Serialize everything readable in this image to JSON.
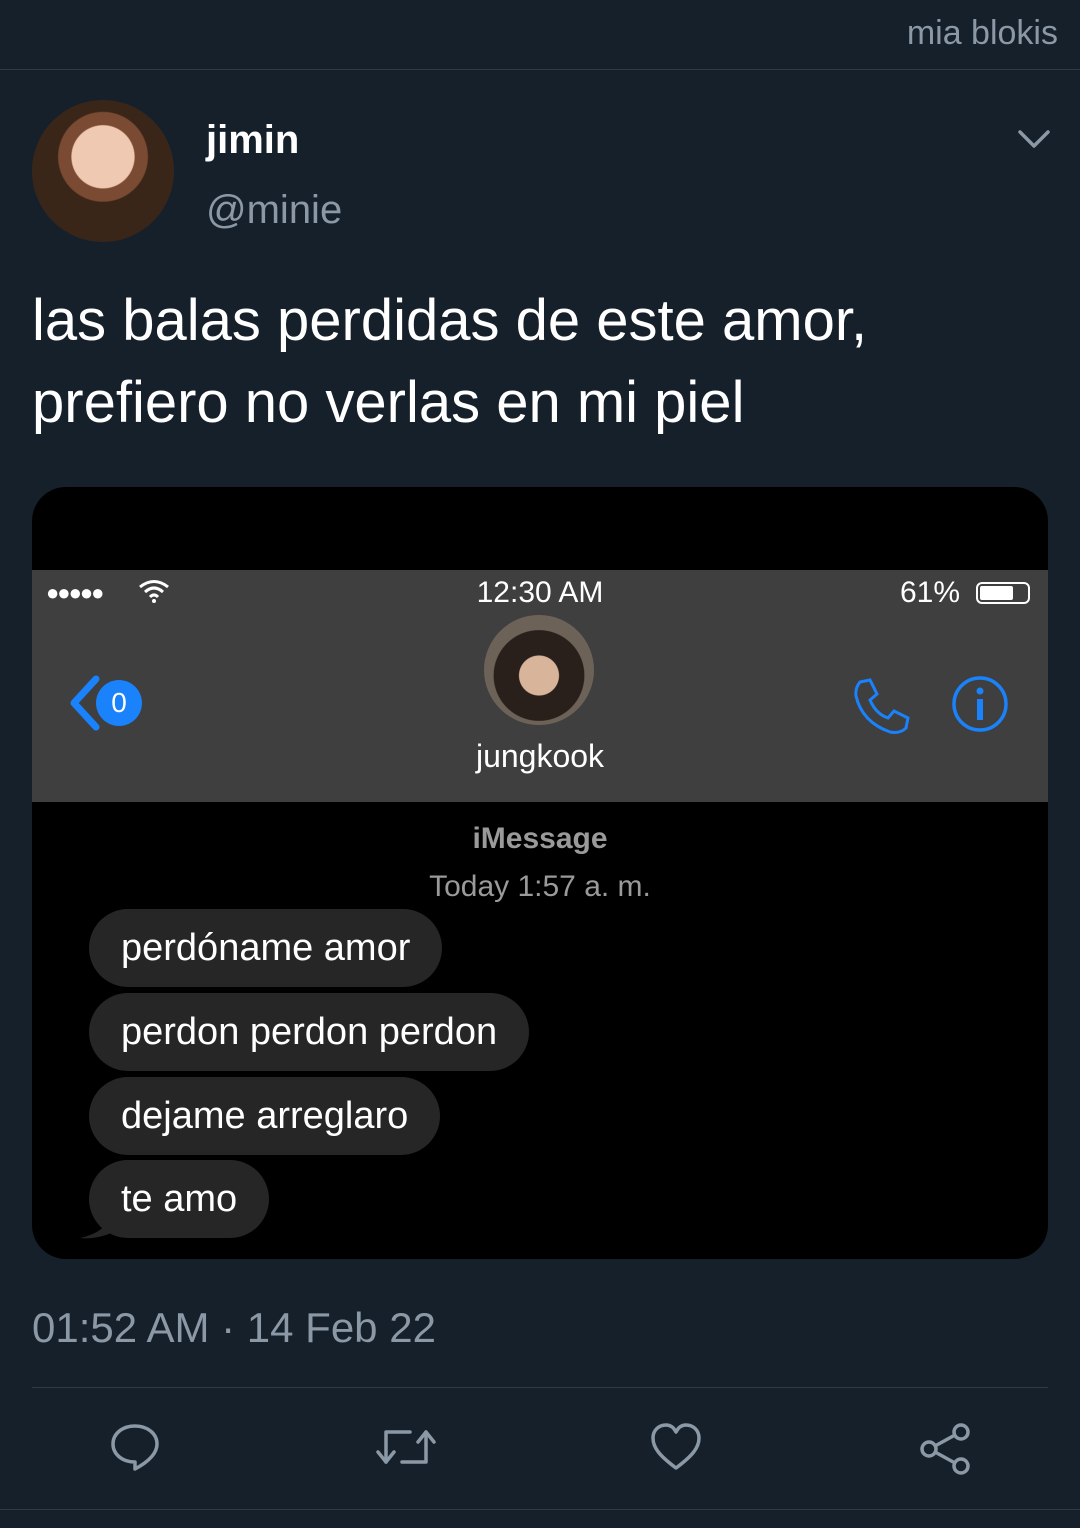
{
  "topbar": {
    "handle": "mia blokis"
  },
  "tweet": {
    "name": "jimin",
    "username": "@minie",
    "text_line1": "las balas perdidas de este amor,",
    "text_line2": "prefiero no verlas en mi piel",
    "timestamp": "01:52 AM · 14 Feb 22"
  },
  "phone": {
    "signal": "●●●●●",
    "clock": "12:30 AM",
    "battery": "61%",
    "back_badge": "0",
    "contact": "jungkook",
    "service": "iMessage",
    "message_time": "Today 1:57 a. m.",
    "messages": [
      "perdóname amor",
      "perdon  perdon perdon",
      "dejame arreglaro",
      "te amo"
    ]
  },
  "icons": {
    "more": "chevron-down-icon",
    "reply": "reply-icon",
    "retweet": "retweet-icon",
    "like": "heart-icon",
    "share": "share-icon"
  },
  "colors": {
    "background": "#15202b",
    "secondary_text": "#8b98a5",
    "ios_blue": "#1a82fb",
    "bubble": "#262626"
  }
}
